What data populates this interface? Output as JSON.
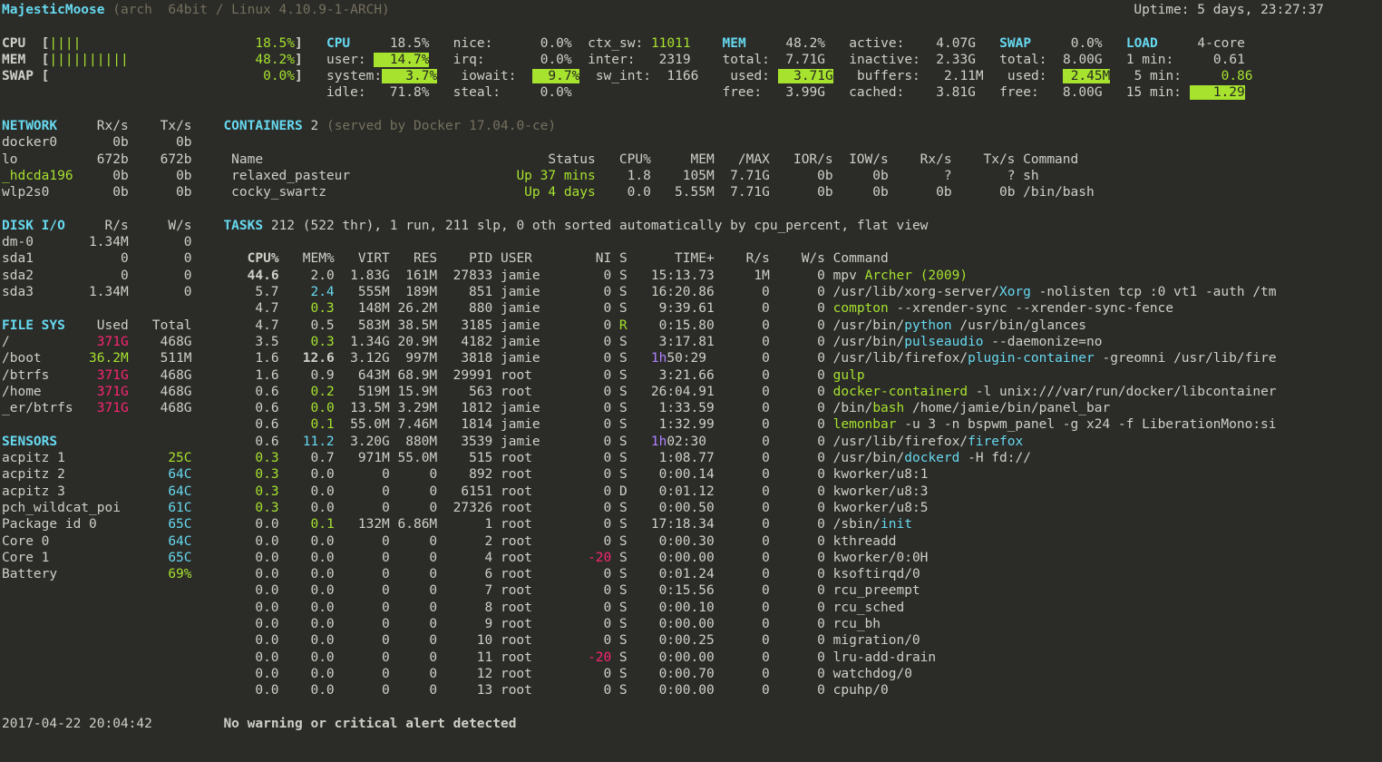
{
  "hostname": "MajesticMoose",
  "sysinfo": "(arch  64bit / Linux 4.10.9-1-ARCH)",
  "uptime": "Uptime: 5 days, 23:27:37",
  "bars": {
    "cpu": {
      "label": "CPU",
      "bar": "||||",
      "pct": "18.5%"
    },
    "mem": {
      "label": "MEM",
      "bar": "||||||||||",
      "pct": "48.2%"
    },
    "swap": {
      "label": "SWAP",
      "bar": "",
      "pct": "0.0%"
    }
  },
  "cpu": {
    "total": "18.5%",
    "user": "14.7%",
    "system": "3.7%",
    "idle": "71.8%",
    "nice": "0.0%",
    "irq": "0.0%",
    "iowait": "9.7%",
    "steal": "0.0%",
    "ctx_sw": "11011",
    "inter": "2319",
    "sw_int": "1166"
  },
  "mem": {
    "pct": "48.2%",
    "total": "7.71G",
    "used": "3.71G",
    "free": "3.99G",
    "active": "4.07G",
    "inactive": "2.33G",
    "buffers": "2.11M",
    "cached": "3.81G"
  },
  "swap": {
    "pct": "0.0%",
    "total": "8.00G",
    "used": "2.45M",
    "free": "8.00G"
  },
  "load": {
    "cores": "4-core",
    "l1": "0.61",
    "l5": "0.86",
    "l15": "1.29"
  },
  "network": {
    "header": "NETWORK",
    "cols": [
      "Rx/s",
      "Tx/s"
    ],
    "ifaces": [
      {
        "name": "docker0",
        "rx": "0b",
        "tx": "0b"
      },
      {
        "name": "lo",
        "rx": "672b",
        "tx": "672b"
      },
      {
        "name": "_hdcda196",
        "rx": "0b",
        "tx": "0b",
        "hl": true
      },
      {
        "name": "wlp2s0",
        "rx": "0b",
        "tx": "0b"
      }
    ]
  },
  "containers": {
    "header": "CONTAINERS",
    "count": "2",
    "info": "(served by Docker 17.04.0-ce)",
    "cols": [
      "Name",
      "Status",
      "CPU%",
      "MEM",
      "/MAX",
      "IOR/s",
      "IOW/s",
      "Rx/s",
      "Tx/s",
      "Command"
    ],
    "rows": [
      {
        "name": "relaxed_pasteur",
        "status": "Up 37 mins",
        "cpu": "1.8",
        "mem": "105M",
        "max": "7.71G",
        "ior": "0b",
        "iow": "0b",
        "rx": "?",
        "tx": "?",
        "cmd": "sh"
      },
      {
        "name": "cocky_swartz",
        "status": "Up 4 days",
        "cpu": "0.0",
        "mem": "5.55M",
        "max": "7.71G",
        "ior": "0b",
        "iow": "0b",
        "rx": "0b",
        "tx": "0b",
        "cmd": "/bin/bash"
      }
    ]
  },
  "diskio": {
    "header": "DISK I/O",
    "cols": [
      "R/s",
      "W/s"
    ],
    "rows": [
      {
        "name": "dm-0",
        "r": "1.34M",
        "w": "0"
      },
      {
        "name": "sda1",
        "r": "0",
        "w": "0"
      },
      {
        "name": "sda2",
        "r": "0",
        "w": "0"
      },
      {
        "name": "sda3",
        "r": "1.34M",
        "w": "0"
      }
    ]
  },
  "fs": {
    "header": "FILE SYS",
    "cols": [
      "Used",
      "Total"
    ],
    "rows": [
      {
        "name": "/",
        "used": "371G",
        "total": "468G",
        "warn": true
      },
      {
        "name": "/boot",
        "used": "36.2M",
        "total": "511M"
      },
      {
        "name": "/btrfs",
        "used": "371G",
        "total": "468G",
        "warn": true
      },
      {
        "name": "/home",
        "used": "371G",
        "total": "468G",
        "warn": true
      },
      {
        "name": "_er/btrfs",
        "used": "371G",
        "total": "468G",
        "warn": true
      }
    ]
  },
  "sensors": {
    "header": "SENSORS",
    "rows": [
      {
        "name": "acpitz 1",
        "val": "25C",
        "cls": "green"
      },
      {
        "name": "acpitz 2",
        "val": "64C",
        "cls": "cyan"
      },
      {
        "name": "acpitz 3",
        "val": "64C",
        "cls": "cyan"
      },
      {
        "name": "pch_wildcat_poi",
        "val": "61C",
        "cls": "cyan"
      },
      {
        "name": "Package id 0",
        "val": "65C",
        "cls": "cyan"
      },
      {
        "name": "Core 0",
        "val": "64C",
        "cls": "cyan"
      },
      {
        "name": "Core 1",
        "val": "65C",
        "cls": "cyan"
      },
      {
        "name": "Battery",
        "val": "69%",
        "cls": "green"
      }
    ]
  },
  "tasks": {
    "header": "TASKS",
    "summary": "212 (522 thr), 1 run, 211 slp, 0 oth sorted automatically by cpu_percent, flat view",
    "cols": [
      "CPU%",
      "MEM%",
      "VIRT",
      "RES",
      "PID",
      "USER",
      "NI",
      "S",
      "TIME+",
      "R/s",
      "W/s",
      "Command"
    ],
    "rows": [
      {
        "cpu": "44.6",
        "cpuB": true,
        "mem": "2.0",
        "virt": "1.83G",
        "res": "161M",
        "pid": "27833",
        "user": "jamie",
        "ni": "0",
        "s": "S",
        "time": "15:13.73",
        "rs": "1M",
        "ws": "0",
        "cmd": [
          [
            "",
            "mpv"
          ],
          [
            "g",
            " Archer (2009)"
          ]
        ]
      },
      {
        "cpu": "5.7",
        "mem": "2.4",
        "memC": "cyan",
        "virt": "555M",
        "res": "189M",
        "pid": "851",
        "user": "jamie",
        "ni": "0",
        "s": "S",
        "time": "16:20.86",
        "rs": "0",
        "ws": "0",
        "cmd": [
          [
            "",
            "/usr/lib/xorg-server/"
          ],
          [
            "c",
            "Xorg"
          ],
          [
            "",
            " -nolisten tcp :0 vt1 -auth /tm"
          ]
        ]
      },
      {
        "cpu": "4.7",
        "mem": "0.3",
        "memC": "green",
        "virt": "148M",
        "res": "26.2M",
        "pid": "880",
        "user": "jamie",
        "ni": "0",
        "s": "S",
        "time": "9:39.61",
        "rs": "0",
        "ws": "0",
        "cmd": [
          [
            "g",
            "compton"
          ],
          [
            "",
            " --xrender-sync --xrender-sync-fence"
          ]
        ]
      },
      {
        "cpu": "4.7",
        "mem": "0.5",
        "virt": "583M",
        "res": "38.5M",
        "pid": "3185",
        "user": "jamie",
        "ni": "0",
        "s": "R",
        "sC": "green",
        "time": "0:15.80",
        "rs": "0",
        "ws": "0",
        "cmd": [
          [
            "",
            "/usr/bin/"
          ],
          [
            "c",
            "python"
          ],
          [
            "",
            " /usr/bin/glances"
          ]
        ]
      },
      {
        "cpu": "3.5",
        "mem": "0.3",
        "memC": "green",
        "virt": "1.34G",
        "res": "20.9M",
        "pid": "4182",
        "user": "jamie",
        "ni": "0",
        "s": "S",
        "time": "3:17.81",
        "rs": "0",
        "ws": "0",
        "cmd": [
          [
            "",
            "/usr/bin/"
          ],
          [
            "c",
            "pulseaudio"
          ],
          [
            "",
            " --daemonize=no"
          ]
        ]
      },
      {
        "cpu": "1.6",
        "mem": "12.6",
        "memB": true,
        "virt": "3.12G",
        "res": "997M",
        "pid": "3818",
        "user": "jamie",
        "ni": "0",
        "s": "S",
        "timeP": "1h",
        "time": "50:29",
        "rs": "0",
        "ws": "0",
        "cmd": [
          [
            "",
            "/usr/lib/firefox/"
          ],
          [
            "c",
            "plugin-container"
          ],
          [
            "",
            " -greomni /usr/lib/fire"
          ]
        ]
      },
      {
        "cpu": "1.6",
        "mem": "0.9",
        "virt": "643M",
        "res": "68.9M",
        "pid": "29991",
        "user": "root",
        "ni": "0",
        "s": "S",
        "time": "3:21.66",
        "rs": "0",
        "ws": "0",
        "cmd": [
          [
            "g",
            "gulp"
          ]
        ]
      },
      {
        "cpu": "0.6",
        "mem": "0.2",
        "memC": "green",
        "virt": "519M",
        "res": "15.9M",
        "pid": "563",
        "user": "root",
        "ni": "0",
        "s": "S",
        "time": "26:04.91",
        "rs": "0",
        "ws": "0",
        "cmd": [
          [
            "g",
            "docker-containerd"
          ],
          [
            "",
            " -l unix:///var/run/docker/libcontainer"
          ]
        ]
      },
      {
        "cpu": "0.6",
        "mem": "0.0",
        "memC": "green",
        "virt": "13.5M",
        "res": "3.29M",
        "pid": "1812",
        "user": "jamie",
        "ni": "0",
        "s": "S",
        "time": "1:33.59",
        "rs": "0",
        "ws": "0",
        "cmd": [
          [
            "",
            "/bin/"
          ],
          [
            "g",
            "bash"
          ],
          [
            "",
            " /home/jamie/bin/panel_bar"
          ]
        ]
      },
      {
        "cpu": "0.6",
        "mem": "0.1",
        "memC": "green",
        "virt": "55.0M",
        "res": "7.46M",
        "pid": "1814",
        "user": "jamie",
        "ni": "0",
        "s": "S",
        "time": "1:32.99",
        "rs": "0",
        "ws": "0",
        "cmd": [
          [
            "g",
            "lemonbar"
          ],
          [
            "",
            " -u 3 -n bspwm_panel -g x24 -f LiberationMono:si"
          ]
        ]
      },
      {
        "cpu": "0.6",
        "mem": "11.2",
        "memC": "cyan",
        "virt": "3.20G",
        "res": "880M",
        "pid": "3539",
        "user": "jamie",
        "ni": "0",
        "s": "S",
        "timeP": "1h",
        "time": "02:30",
        "rs": "0",
        "ws": "0",
        "cmd": [
          [
            "",
            "/usr/lib/firefox/"
          ],
          [
            "c",
            "firefox"
          ]
        ]
      },
      {
        "cpu": "0.3",
        "cpuC": "green",
        "mem": "0.7",
        "virt": "971M",
        "res": "55.0M",
        "pid": "515",
        "user": "root",
        "ni": "0",
        "s": "S",
        "time": "1:08.77",
        "rs": "0",
        "ws": "0",
        "cmd": [
          [
            "",
            "/usr/bin/"
          ],
          [
            "c",
            "dockerd"
          ],
          [
            "",
            " -H fd://"
          ]
        ]
      },
      {
        "cpu": "0.3",
        "cpuC": "green",
        "mem": "0.0",
        "virt": "0",
        "res": "0",
        "pid": "892",
        "user": "root",
        "ni": "0",
        "s": "S",
        "time": "0:00.14",
        "rs": "0",
        "ws": "0",
        "cmd": [
          [
            "",
            "kworker/u8:1"
          ]
        ]
      },
      {
        "cpu": "0.3",
        "cpuC": "green",
        "mem": "0.0",
        "virt": "0",
        "res": "0",
        "pid": "6151",
        "user": "root",
        "ni": "0",
        "s": "D",
        "time": "0:01.12",
        "rs": "0",
        "ws": "0",
        "cmd": [
          [
            "",
            "kworker/u8:3"
          ]
        ]
      },
      {
        "cpu": "0.3",
        "cpuC": "green",
        "mem": "0.0",
        "virt": "0",
        "res": "0",
        "pid": "27326",
        "user": "root",
        "ni": "0",
        "s": "S",
        "time": "0:00.50",
        "rs": "0",
        "ws": "0",
        "cmd": [
          [
            "",
            "kworker/u8:5"
          ]
        ]
      },
      {
        "cpu": "0.0",
        "mem": "0.1",
        "memC": "green",
        "virt": "132M",
        "res": "6.86M",
        "pid": "1",
        "user": "root",
        "ni": "0",
        "s": "S",
        "time": "17:18.34",
        "rs": "0",
        "ws": "0",
        "cmd": [
          [
            "",
            "/sbin/"
          ],
          [
            "c",
            "init"
          ]
        ]
      },
      {
        "cpu": "0.0",
        "mem": "0.0",
        "virt": "0",
        "res": "0",
        "pid": "2",
        "user": "root",
        "ni": "0",
        "s": "S",
        "time": "0:00.30",
        "rs": "0",
        "ws": "0",
        "cmd": [
          [
            "",
            "kthreadd"
          ]
        ]
      },
      {
        "cpu": "0.0",
        "mem": "0.0",
        "virt": "0",
        "res": "0",
        "pid": "4",
        "user": "root",
        "ni": "-20",
        "niC": "magenta",
        "s": "S",
        "time": "0:00.00",
        "rs": "0",
        "ws": "0",
        "cmd": [
          [
            "",
            "kworker/0:0H"
          ]
        ]
      },
      {
        "cpu": "0.0",
        "mem": "0.0",
        "virt": "0",
        "res": "0",
        "pid": "6",
        "user": "root",
        "ni": "0",
        "s": "S",
        "time": "0:01.24",
        "rs": "0",
        "ws": "0",
        "cmd": [
          [
            "",
            "ksoftirqd/0"
          ]
        ]
      },
      {
        "cpu": "0.0",
        "mem": "0.0",
        "virt": "0",
        "res": "0",
        "pid": "7",
        "user": "root",
        "ni": "0",
        "s": "S",
        "time": "0:15.56",
        "rs": "0",
        "ws": "0",
        "cmd": [
          [
            "",
            "rcu_preempt"
          ]
        ]
      },
      {
        "cpu": "0.0",
        "mem": "0.0",
        "virt": "0",
        "res": "0",
        "pid": "8",
        "user": "root",
        "ni": "0",
        "s": "S",
        "time": "0:00.10",
        "rs": "0",
        "ws": "0",
        "cmd": [
          [
            "",
            "rcu_sched"
          ]
        ]
      },
      {
        "cpu": "0.0",
        "mem": "0.0",
        "virt": "0",
        "res": "0",
        "pid": "9",
        "user": "root",
        "ni": "0",
        "s": "S",
        "time": "0:00.00",
        "rs": "0",
        "ws": "0",
        "cmd": [
          [
            "",
            "rcu_bh"
          ]
        ]
      },
      {
        "cpu": "0.0",
        "mem": "0.0",
        "virt": "0",
        "res": "0",
        "pid": "10",
        "user": "root",
        "ni": "0",
        "s": "S",
        "time": "0:00.25",
        "rs": "0",
        "ws": "0",
        "cmd": [
          [
            "",
            "migration/0"
          ]
        ]
      },
      {
        "cpu": "0.0",
        "mem": "0.0",
        "virt": "0",
        "res": "0",
        "pid": "11",
        "user": "root",
        "ni": "-20",
        "niC": "magenta",
        "s": "S",
        "time": "0:00.00",
        "rs": "0",
        "ws": "0",
        "cmd": [
          [
            "",
            "lru-add-drain"
          ]
        ]
      },
      {
        "cpu": "0.0",
        "mem": "0.0",
        "virt": "0",
        "res": "0",
        "pid": "12",
        "user": "root",
        "ni": "0",
        "s": "S",
        "time": "0:00.70",
        "rs": "0",
        "ws": "0",
        "cmd": [
          [
            "",
            "watchdog/0"
          ]
        ]
      },
      {
        "cpu": "0.0",
        "mem": "0.0",
        "virt": "0",
        "res": "0",
        "pid": "13",
        "user": "root",
        "ni": "0",
        "s": "S",
        "time": "0:00.00",
        "rs": "0",
        "ws": "0",
        "cmd": [
          [
            "",
            "cpuhp/0"
          ]
        ]
      }
    ]
  },
  "footer": {
    "time": "2017-04-22 20:04:42",
    "msg": "No warning or critical alert detected"
  }
}
